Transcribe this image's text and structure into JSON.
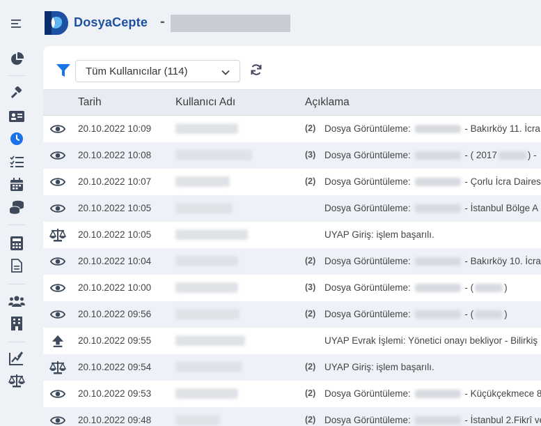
{
  "app": {
    "brand": "DosyaCepte",
    "title_separator": "-"
  },
  "filter": {
    "selected": "Tüm Kullanıcılar (114)"
  },
  "table": {
    "headers": {
      "date": "Tarih",
      "user": "Kullanıcı Adı",
      "desc": "Açıklama"
    },
    "rows": [
      {
        "icon": "eye-icon",
        "date": "20.10.2022 10:09",
        "count": "(2)",
        "desc_a": "Dosya Görüntüleme:",
        "desc_b": "- Bakırköy 11. İcra",
        "mid": "",
        "mid_b": ""
      },
      {
        "icon": "eye-icon",
        "date": "20.10.2022 10:08",
        "count": "(3)",
        "desc_a": "Dosya Görüntüleme:",
        "desc_b": "- ( 2017",
        "mid": ") -",
        "mid_b": ""
      },
      {
        "icon": "eye-icon",
        "date": "20.10.2022 10:07",
        "count": "(2)",
        "desc_a": "Dosya Görüntüleme:",
        "desc_b": "- Çorlu İcra Dairesi",
        "mid": "",
        "mid_b": ""
      },
      {
        "icon": "eye-icon",
        "date": "20.10.2022 10:05",
        "count": "",
        "desc_a": "Dosya Görüntüleme:",
        "desc_b": "- İstanbul Bölge A",
        "mid": "",
        "mid_b": ""
      },
      {
        "icon": "scale-icon",
        "date": "20.10.2022 10:05",
        "count": "",
        "desc_a": "UYAP Giriş: işlem başarılı.",
        "desc_b": "",
        "mid": "",
        "mid_b": ""
      },
      {
        "icon": "eye-icon",
        "date": "20.10.2022 10:04",
        "count": "(2)",
        "desc_a": "Dosya Görüntüleme:",
        "desc_b": "- Bakırköy 10. İcra",
        "mid": "",
        "mid_b": ""
      },
      {
        "icon": "eye-icon",
        "date": "20.10.2022 10:00",
        "count": "(3)",
        "desc_a": "Dosya Görüntüleme:",
        "desc_b": "- (",
        "mid": ")",
        "mid_b": ""
      },
      {
        "icon": "eye-icon",
        "date": "20.10.2022 09:56",
        "count": "(2)",
        "desc_a": "Dosya Görüntüleme:",
        "desc_b": "- (",
        "mid": ")",
        "mid_b": ""
      },
      {
        "icon": "upload-icon",
        "date": "20.10.2022 09:55",
        "count": "",
        "desc_a": "UYAP Evrak İşlemi: Yönetici onayı bekliyor - Bilirkiş",
        "desc_b": "",
        "mid": "",
        "mid_b": ""
      },
      {
        "icon": "scale-icon",
        "date": "20.10.2022 09:54",
        "count": "(2)",
        "desc_a": "UYAP Giriş: işlem başarılı.",
        "desc_b": "",
        "mid": "",
        "mid_b": ""
      },
      {
        "icon": "eye-icon",
        "date": "20.10.2022 09:53",
        "count": "(2)",
        "desc_a": "Dosya Görüntüleme:",
        "desc_b": "- Küçükçekmece 8.",
        "mid": "",
        "mid_b": ""
      },
      {
        "icon": "eye-icon",
        "date": "20.10.2022 09:48",
        "count": "(2)",
        "desc_a": "Dosya Görüntüleme:",
        "desc_b": "- İstanbul 2.Fikrî ve",
        "mid": "",
        "mid_b": ""
      }
    ]
  },
  "sidebar": {
    "icons": [
      "menu-icon",
      "chart-pie-icon",
      "gavel-icon",
      "id-card-icon",
      "clock-icon",
      "task-list-icon",
      "calendar-icon",
      "coins-icon",
      "calculator-icon",
      "document-icon",
      "users-icon",
      "building-icon",
      "report-icon",
      "scale-icon"
    ]
  },
  "colors": {
    "accent": "#1a73e8",
    "icon": "#3e4a5c",
    "brand": "#1d4fa3"
  }
}
